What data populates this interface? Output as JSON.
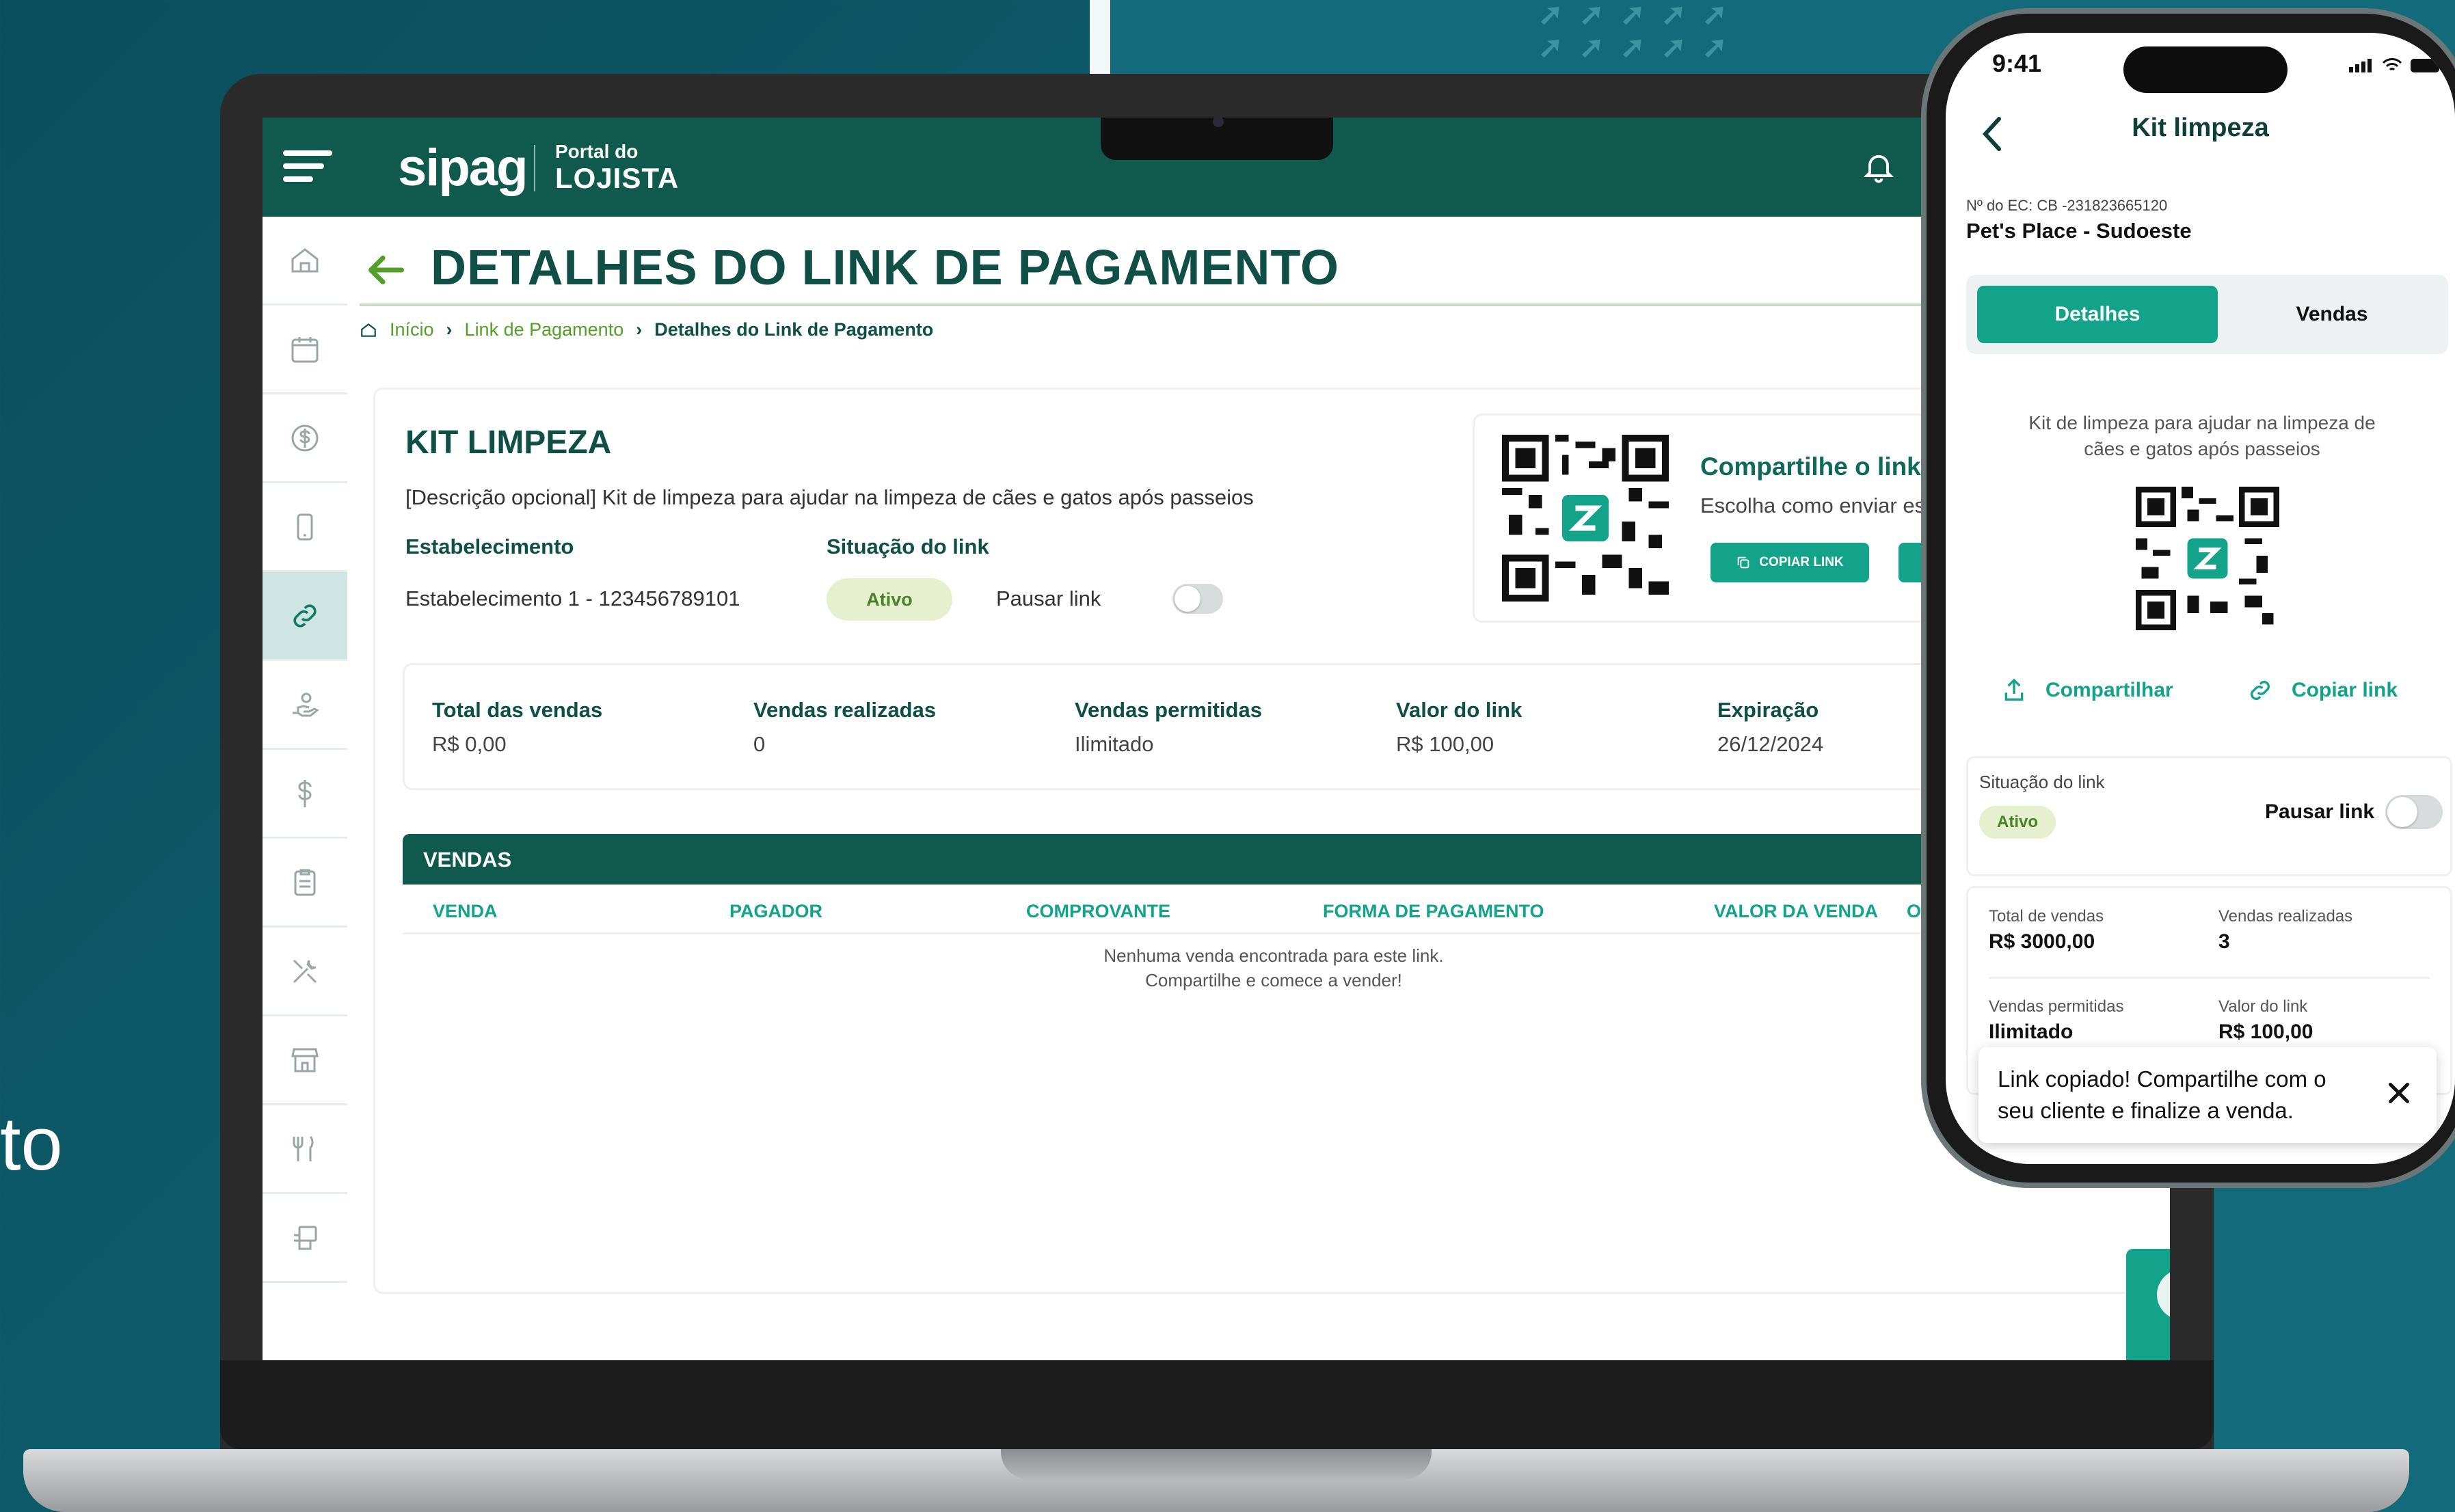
{
  "background": {
    "side_text": "to",
    "accent": "#0b4e5c"
  },
  "laptop": {
    "header": {
      "brand": "sipag",
      "portal_line1": "Portal do",
      "portal_line2": "LOJISTA"
    },
    "page_title": "DETALHES DO LINK DE PAGAMENTO",
    "breadcrumb": {
      "home": "Início",
      "link": "Link de Pagamento",
      "current": "Detalhes do Link de Pagamento"
    },
    "product": {
      "name": "KIT LIMPEZA",
      "description": "[Descrição opcional] Kit de limpeza para ajudar na limpeza de cães e gatos após passeios",
      "establishment_label": "Estabelecimento",
      "establishment_value": "Estabelecimento 1 - 123456789101",
      "status_label": "Situação do link",
      "status_value": "Ativo",
      "pause_label": "Pausar link",
      "pause_on": false
    },
    "share": {
      "title": "Compartilhe o link",
      "subtitle": "Escolha como enviar este",
      "copy_button": "COPIAR LINK"
    },
    "stats": [
      {
        "label": "Total das vendas",
        "value": "R$ 0,00"
      },
      {
        "label": "Vendas realizadas",
        "value": "0"
      },
      {
        "label": "Vendas permitidas",
        "value": "Ilimitado"
      },
      {
        "label": "Valor do link",
        "value": "R$ 100,00"
      },
      {
        "label": "Expiração",
        "value": "26/12/2024"
      }
    ],
    "sales": {
      "title": "VENDAS",
      "columns": [
        "VENDA",
        "PAGADOR",
        "COMPROVANTE",
        "FORMA DE PAGAMENTO",
        "VALOR DA VENDA",
        "O"
      ],
      "empty_line1": "Nenhuma venda encontrada para este link.",
      "empty_line2": "Compartilhe e comece a vender!"
    },
    "sidebar": [
      "home-icon",
      "calendar-icon",
      "dollar-circle-icon",
      "phone-icon",
      "link-icon",
      "money-hand-icon",
      "dollar-icon",
      "clipboard-icon",
      "tools-icon",
      "store-icon",
      "utensils-icon",
      "pos-terminal-icon"
    ]
  },
  "phone": {
    "time": "9:41",
    "title": "Kit limpeza",
    "ec_number": "Nº do EC: CB -231823665120",
    "shop_name": "Pet's Place - Sudoeste",
    "tabs": [
      "Detalhes",
      "Vendas"
    ],
    "description": "Kit de limpeza para ajudar na limpeza de cães e gatos após passeios",
    "share_label": "Compartilhar",
    "copy_label": "Copiar link",
    "status_label": "Situação do link",
    "status_value": "Ativo",
    "pause_label": "Pausar link",
    "pause_on": false,
    "stats": [
      {
        "label": "Total de vendas",
        "value": "R$ 3000,00"
      },
      {
        "label": "Vendas realizadas",
        "value": "3"
      },
      {
        "label": "Vendas permitidas",
        "value": "Ilimitado"
      },
      {
        "label": "Valor do link",
        "value": "R$ 100,00"
      }
    ],
    "toast": "Link copiado! Compartilhe com o seu cliente e finalize a venda."
  }
}
